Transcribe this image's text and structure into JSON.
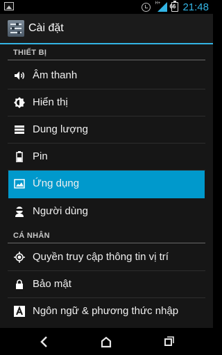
{
  "status_bar": {
    "time": "21:48",
    "battery_level": "66",
    "network_label": "H+",
    "icons": [
      "gallery-icon",
      "alarm-clock-icon",
      "signal-icon",
      "battery-icon"
    ]
  },
  "action_bar": {
    "title": "Cài đặt",
    "icon": "settings-app-icon"
  },
  "sections": [
    {
      "header": "THIẾT BỊ",
      "items": [
        {
          "label": "Âm thanh",
          "icon": "speaker-icon"
        },
        {
          "label": "Hiển thị",
          "icon": "brightness-icon"
        },
        {
          "label": "Dung lượng",
          "icon": "storage-icon"
        },
        {
          "label": "Pin",
          "icon": "battery-icon"
        },
        {
          "label": "Ứng dụng",
          "icon": "apps-icon",
          "selected": true
        },
        {
          "label": "Người dùng",
          "icon": "user-icon"
        }
      ]
    },
    {
      "header": "CÁ NHÂN",
      "items": [
        {
          "label": "Quyền truy cập thông tin vị trí",
          "icon": "location-icon"
        },
        {
          "label": "Bảo mật",
          "icon": "lock-icon"
        },
        {
          "label": "Ngôn ngữ & phương thức nhập",
          "icon": "language-icon"
        }
      ]
    }
  ],
  "nav_bar": {
    "buttons": [
      "back-icon",
      "home-icon",
      "recents-icon"
    ]
  },
  "colors": {
    "accent": "#33b5e5",
    "selected_bg": "#0099cc",
    "background": "#161616"
  }
}
